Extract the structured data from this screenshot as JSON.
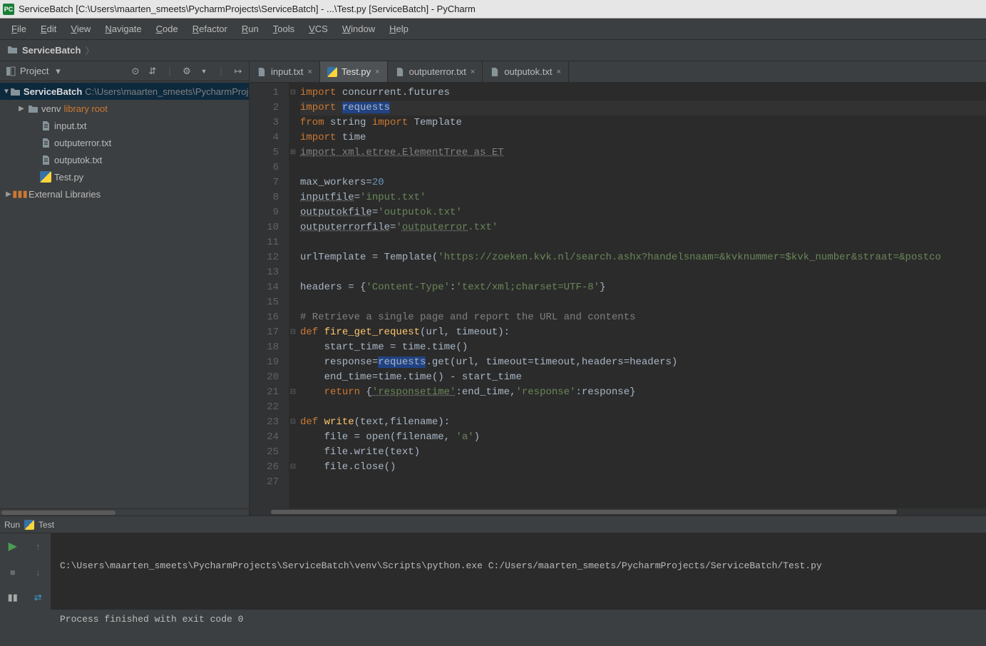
{
  "title": "ServiceBatch [C:\\Users\\maarten_smeets\\PycharmProjects\\ServiceBatch] - ...\\Test.py [ServiceBatch] - PyCharm",
  "menubar": [
    "File",
    "Edit",
    "View",
    "Navigate",
    "Code",
    "Refactor",
    "Run",
    "Tools",
    "VCS",
    "Window",
    "Help"
  ],
  "breadcrumb": {
    "root": "ServiceBatch"
  },
  "project_tool": {
    "title": "Project"
  },
  "tree": {
    "root": {
      "name": "ServiceBatch",
      "path": "C:\\Users\\maarten_smeets\\PycharmProjects\\ServiceBatch"
    },
    "venv": {
      "name": "venv",
      "note": "library root"
    },
    "files": [
      "input.txt",
      "outputerror.txt",
      "outputok.txt",
      "Test.py"
    ],
    "ext": "External Libraries"
  },
  "tabs": [
    {
      "name": "input.txt",
      "type": "txt"
    },
    {
      "name": "Test.py",
      "type": "py",
      "active": true
    },
    {
      "name": "outputerror.txt",
      "type": "txt"
    },
    {
      "name": "outputok.txt",
      "type": "txt"
    }
  ],
  "code_lines": 27,
  "code": {
    "l1": {
      "a": "import ",
      "b": "concurrent.futures"
    },
    "l2": {
      "a": "import ",
      "b": "requests"
    },
    "l3": {
      "a": "from ",
      "b": "string ",
      "c": "import ",
      "d": "Template"
    },
    "l4": {
      "a": "import ",
      "b": "time"
    },
    "l5": {
      "a": "import ",
      "b": "xml.etree.ElementTree as ET"
    },
    "l7": {
      "a": "max_workers=",
      "b": "20"
    },
    "l8": {
      "a": "inputfile=",
      "b": "'input.txt'"
    },
    "l9": {
      "a": "outputokfile",
      "b": "=",
      "c": "'outputok.txt'"
    },
    "l10": {
      "a": "outputerrorfile",
      "b": "=",
      "c": "'outputerror",
      "d": ".txt'"
    },
    "l12": {
      "a": "urlTemplate = Template(",
      "b": "'https://zoeken.kvk.nl/search.ashx?handelsnaam=&kvknummer=$kvk_number&straat=&postco"
    },
    "l14": {
      "a": "headers = {",
      "b": "'Content-Type'",
      "c": ":",
      "d": "'text/xml;charset=UTF-8'",
      "e": "}"
    },
    "l16": "# Retrieve a single page and report the URL and contents",
    "l17": {
      "a": "def ",
      "b": "fire_get_request",
      "c": "(url, timeout):"
    },
    "l18": "    start_time = time.time()",
    "l19": {
      "a": "    response=",
      "b": "requests",
      "c": ".get(url, ",
      "d": "timeout",
      "e": "=timeout,",
      "f": "headers",
      "g": "=headers)"
    },
    "l20": "    end_time=time.time() - start_time",
    "l21": {
      "a": "    ",
      "b": "return ",
      "c": "{",
      "d": "'responsetime'",
      "e": ":end_time,",
      "f": "'response'",
      "g": ":response}"
    },
    "l23": {
      "a": "def ",
      "b": "write",
      "c": "(text,filename):"
    },
    "l24": {
      "a": "    file = open(filename, ",
      "b": "'a'",
      "c": ")"
    },
    "l25": "    file.write(text)",
    "l26": "    file.close()"
  },
  "runtab": {
    "label": "Run",
    "config": "Test"
  },
  "console": {
    "line1": "C:\\Users\\maarten_smeets\\PycharmProjects\\ServiceBatch\\venv\\Scripts\\python.exe C:/Users/maarten_smeets/PycharmProjects/ServiceBatch/Test.py",
    "line2": "",
    "line3": "Process finished with exit code 0"
  }
}
